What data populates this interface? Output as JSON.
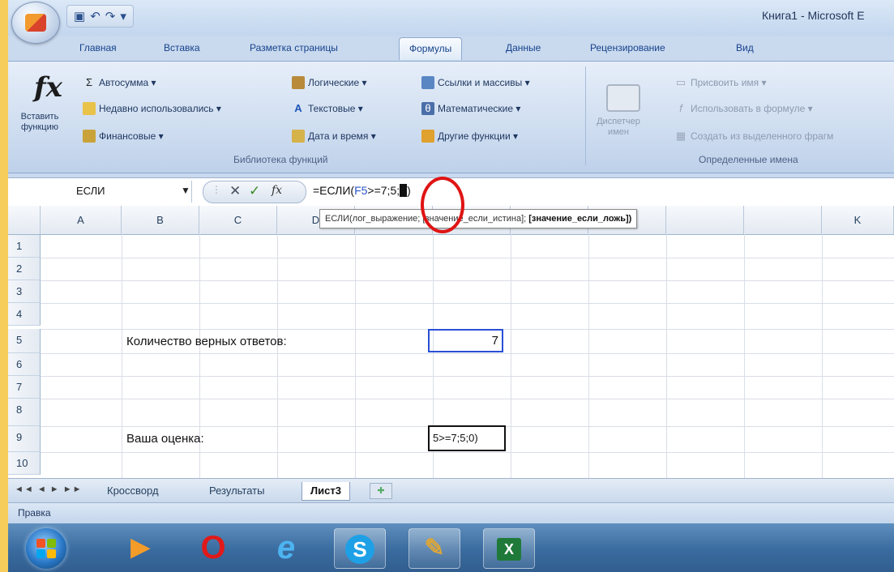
{
  "window": {
    "title": "Книга1 - Microsoft E"
  },
  "tabs": [
    "Главная",
    "Вставка",
    "Разметка страницы",
    "Формулы",
    "Данные",
    "Рецензирование",
    "Вид"
  ],
  "active_tab": "Формулы",
  "ribbon": {
    "insert_function": "Вставить функцию",
    "library": {
      "autosum": "Автосумма ▾",
      "recent": "Недавно использовались ▾",
      "financial": "Финансовые ▾",
      "logical": "Логические ▾",
      "text": "Текстовые ▾",
      "datetime": "Дата и время ▾",
      "lookup": "Ссылки и массивы ▾",
      "math": "Математические ▾",
      "more": "Другие функции ▾",
      "group_label": "Библиотека функций"
    },
    "names": {
      "manager": "Диспетчер имен",
      "assign": "Присвоить имя ▾",
      "use_in_formula": "Использовать в формуле ▾",
      "create_from_sel": "Создать из выделенного фрагм",
      "group_label": "Определенные имена"
    }
  },
  "formula_bar": {
    "name_box": "ЕСЛИ",
    "formula_prefix": "=ЕСЛИ(",
    "formula_ref": "F5",
    "formula_mid": ">=7;5;",
    "formula_suffix": ")"
  },
  "tooltip": {
    "text": "ЕСЛИ(лог_выражение; [значение_если_истина]; ",
    "bold": "[значение_если_ложь])"
  },
  "columns": [
    "A",
    "B",
    "C",
    "D",
    "",
    "",
    "",
    "",
    "",
    "K"
  ],
  "rows": [
    "1",
    "2",
    "3",
    "4",
    "5",
    "6",
    "7",
    "8",
    "9",
    "10"
  ],
  "cells": {
    "b5": "Количество верных ответов:",
    "f5": "7",
    "b9": "Ваша оценка:",
    "f9": "5>=7;5;0)"
  },
  "sheet_tabs": [
    "Кроссворд",
    "Результаты",
    "Лист3"
  ],
  "active_sheet": "Лист3",
  "status": "Правка",
  "colors": {
    "accent": "#15428b",
    "formula_ref": "#2a56c6",
    "highlight_ring": "#e01414"
  }
}
